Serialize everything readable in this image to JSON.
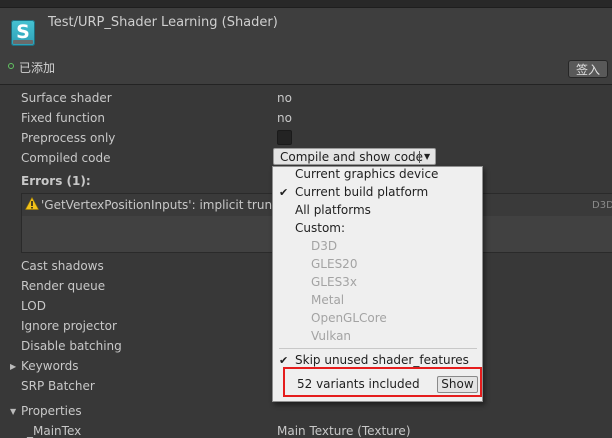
{
  "header": {
    "title": "Test/URP_Shader Learning (Shader)",
    "icon_letter": "S",
    "added_status": "已添加",
    "checkin_button": "签入"
  },
  "properties_list": [
    {
      "label": "Surface shader",
      "value": "no"
    },
    {
      "label": "Fixed function",
      "value": "no"
    },
    {
      "label": "Preprocess only",
      "value": ""
    },
    {
      "label": "Compiled code",
      "value": ""
    }
  ],
  "compile_button": {
    "label": "Compile and show code"
  },
  "errors": {
    "label": "Errors (1):",
    "items": [
      {
        "message": "'GetVertexPositionInputs': implicit truncati",
        "platform": "D3D"
      }
    ]
  },
  "lower_properties": [
    {
      "label": "Cast shadows"
    },
    {
      "label": "Render queue"
    },
    {
      "label": "LOD"
    },
    {
      "label": "Ignore projector"
    },
    {
      "label": "Disable batching"
    },
    {
      "label": "Keywords"
    },
    {
      "label": "SRP Batcher"
    }
  ],
  "properties_section": {
    "label": "Properties",
    "first_row_label": "_MainTex",
    "first_row_value": "Main Texture (Texture)"
  },
  "dropdown": {
    "items": [
      {
        "label": "Current graphics device",
        "checked": false,
        "enabled": true
      },
      {
        "label": "Current build platform",
        "checked": true,
        "enabled": true
      },
      {
        "label": "All platforms",
        "checked": false,
        "enabled": true
      },
      {
        "label": "Custom:",
        "checked": false,
        "enabled": true
      },
      {
        "label": "D3D",
        "checked": false,
        "enabled": false
      },
      {
        "label": "GLES20",
        "checked": false,
        "enabled": false
      },
      {
        "label": "GLES3x",
        "checked": false,
        "enabled": false
      },
      {
        "label": "Metal",
        "checked": false,
        "enabled": false
      },
      {
        "label": "OpenGLCore",
        "checked": false,
        "enabled": false
      },
      {
        "label": "Vulkan",
        "checked": false,
        "enabled": false
      }
    ],
    "skip_unused": {
      "label": "Skip unused shader_features",
      "checked": true
    },
    "variants_text": "52 variants included",
    "show_button": "Show"
  },
  "colors": {
    "background": "#383838",
    "highlight_box": "#e51d1d",
    "shader_icon": "#3bb3c8",
    "added_dot": "#62c462"
  },
  "icons": {
    "shader": "shader-file-icon",
    "warning": "warning-icon",
    "dropdown_arrow": "dropdown-arrow-icon",
    "foldout": "foldout-arrow-icon",
    "check": "checkmark-icon",
    "added": "added-status-icon"
  }
}
